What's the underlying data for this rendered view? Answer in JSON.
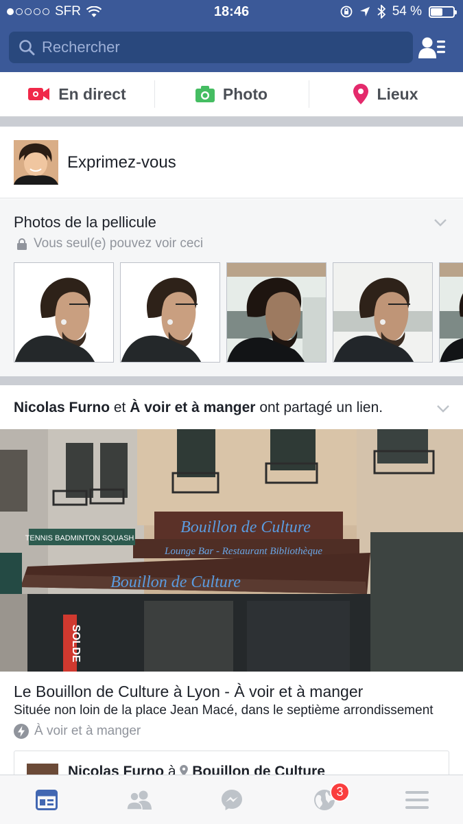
{
  "status_bar": {
    "carrier": "SFR",
    "time": "18:46",
    "battery": "54 %",
    "battery_level": 0.54,
    "signal_bars_filled": 1,
    "signal_bars_total": 5
  },
  "header": {
    "search_placeholder": "Rechercher",
    "friends_icon": "friend-requests-icon",
    "bg_color": "#3b5998"
  },
  "composer_actions": [
    {
      "label": "En direct",
      "icon": "live-video-icon",
      "color": "#f02849"
    },
    {
      "label": "Photo",
      "icon": "camera-icon",
      "color": "#45bd62"
    },
    {
      "label": "Lieux",
      "icon": "location-pin-icon",
      "color": "#e42a6c"
    }
  ],
  "composer": {
    "prompt": "Exprimez-vous"
  },
  "camera_roll": {
    "title": "Photos de la pellicule",
    "privacy": "Vous seul(e) pouvez voir ceci",
    "thumb_count": 5
  },
  "post": {
    "author1": "Nicolas Furno",
    "connector": "et",
    "author2": "À voir et à manger",
    "action": "ont partagé un lien.",
    "photo_sign_main": "Bouillon de Culture",
    "photo_sign_sub": "Lounge Bar - Restaurant Bibliothèque",
    "photo_awning": "Bouillon de Culture",
    "photo_side_sign": "TENNIS  BADMINTON  SQUASH",
    "photo_solde": "SOLDE",
    "link_title": "Le Bouillon de Culture à Lyon - À voir et à manger",
    "link_description": "Située non loin de la place Jean Macé, dans le septième arrondissement",
    "link_source": "À voir et à manger"
  },
  "next_card": {
    "author": "Nicolas Furno",
    "connector": "à",
    "place": "Bouillon de Culture"
  },
  "tabbar": {
    "items": [
      {
        "icon": "news-feed-icon",
        "active": true
      },
      {
        "icon": "friends-icon",
        "active": false
      },
      {
        "icon": "messenger-icon",
        "active": false
      },
      {
        "icon": "notifications-globe-icon",
        "active": false,
        "badge": "3"
      },
      {
        "icon": "menu-icon",
        "active": false
      }
    ],
    "active_color": "#4267b2",
    "inactive_color": "#bec3c9"
  }
}
